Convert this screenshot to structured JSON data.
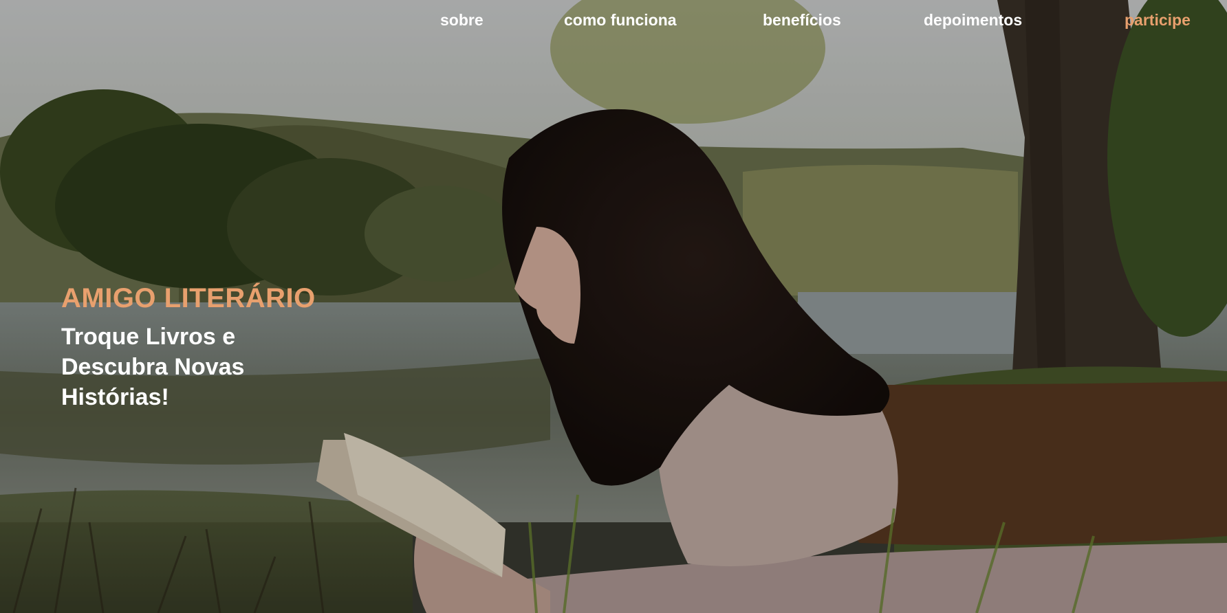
{
  "nav": {
    "items": [
      {
        "label": "sobre"
      },
      {
        "label": "como funciona"
      },
      {
        "label": "benefícios"
      },
      {
        "label": "depoimentos"
      },
      {
        "label": "participe"
      }
    ],
    "accent_color": "#e8a06e",
    "text_color": "#ffffff"
  },
  "hero": {
    "brand": "AMIGO LITERÁRIO",
    "tagline": "Troque Livros e Descubra Novas Histórias!"
  },
  "photo": {
    "subject": "woman-reading-book-outdoors",
    "icon": "hero-photo"
  }
}
